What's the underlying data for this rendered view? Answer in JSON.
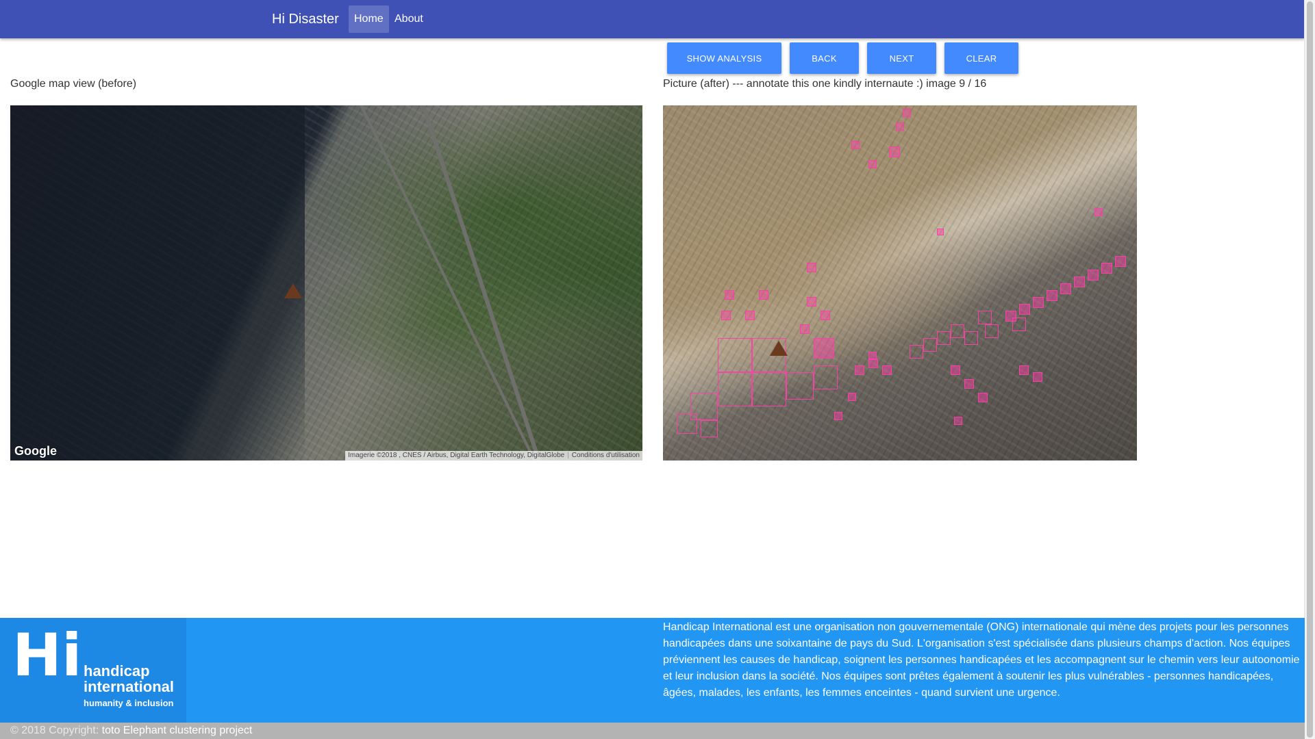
{
  "navbar": {
    "brand": "Hi Disaster",
    "links": [
      {
        "label": "Home",
        "active": true
      },
      {
        "label": "About",
        "active": false
      }
    ],
    "color": "#3f51b5"
  },
  "toolbar": {
    "show_analysis": "SHOW ANALYSIS",
    "back": "BACK",
    "next": "NEXT",
    "clear": "CLEAR",
    "button_color": "#448aff"
  },
  "before": {
    "caption": "Google map view (before)",
    "google_logo": "Google",
    "attribution": "Imagerie ©2018 , CNES / Airbus, Digital Earth Technology, DigitalGlobe",
    "terms": "Conditions d'utilisation",
    "zoom_in": "+",
    "zoom_out": "−",
    "pegman_icon": "street-view-pegman"
  },
  "after": {
    "caption": "Picture (after) --- annotate this one kindly internaute :) image 9 / 16",
    "annotation_color": "#ff3fa8"
  },
  "footer": {
    "logo_mark": "Hi",
    "logo_line1": "handicap",
    "logo_line2": "international",
    "logo_line3": "humanity & inclusion",
    "description": "Handicap International est une organisation non gouvernementale (ONG) internationale qui mène des projets pour les personnes handicapées dans une soixantaine de pays du Sud. L'organisation s'est spécialisée dans plusieurs champs d'action. Nos équipes préviennent les causes de handicap, soignent les personnes handicapées et les accompagnent sur le chemin vers leur autoonomie et leur inclusion dans la société. Nos équipes sont prêtes également à soutenir les plus vulnérables - personnes handicapées, âgées, malades, les enfants, les femmes enceintes - quand survient une urgence.",
    "copyright_prefix": "© 2018 Copyright:",
    "copyright_project": "toto Elephant clustering project",
    "color": "#2196f3"
  }
}
